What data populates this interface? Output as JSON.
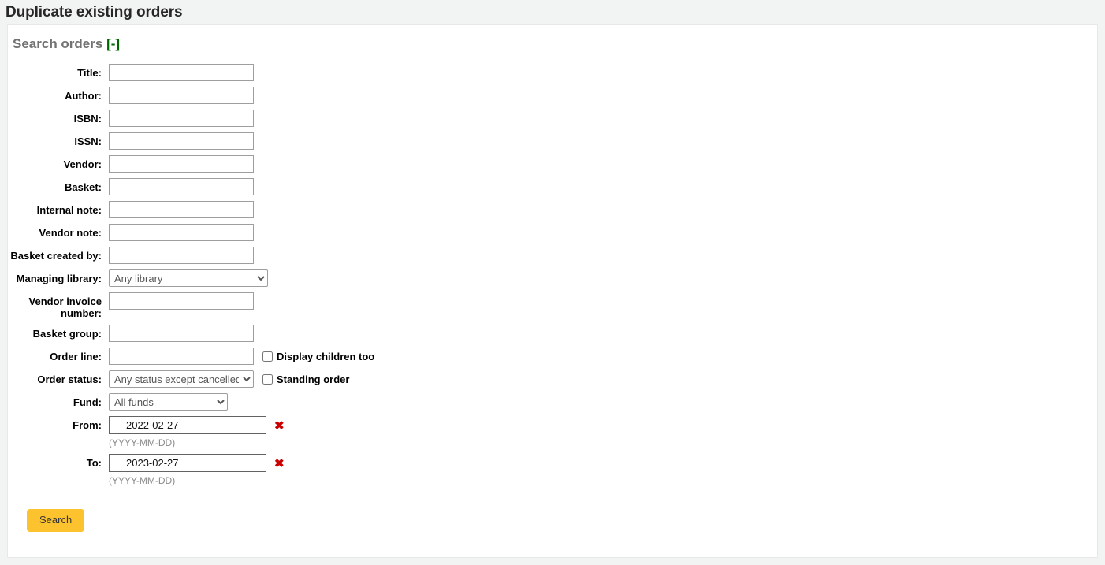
{
  "page": {
    "title": "Duplicate existing orders"
  },
  "panel": {
    "legend": "Search orders",
    "toggle": "[-]",
    "toggle_color": "#006600"
  },
  "form": {
    "fields": [
      {
        "label": "Title:",
        "name": "title",
        "type": "text",
        "value": "",
        "placeholder": ""
      },
      {
        "label": "Author:",
        "name": "author",
        "type": "text",
        "value": "",
        "placeholder": ""
      },
      {
        "label": "ISBN:",
        "name": "isbn",
        "type": "text",
        "value": "",
        "placeholder": ""
      },
      {
        "label": "ISSN:",
        "name": "issn",
        "type": "text",
        "value": "",
        "placeholder": ""
      },
      {
        "label": "Vendor:",
        "name": "vendor",
        "type": "text",
        "value": "",
        "placeholder": ""
      },
      {
        "label": "Basket:",
        "name": "basket",
        "type": "text",
        "value": "",
        "placeholder": ""
      },
      {
        "label": "Internal note:",
        "name": "internal-note",
        "type": "text",
        "value": "",
        "placeholder": ""
      },
      {
        "label": "Vendor note:",
        "name": "vendor-note",
        "type": "text",
        "value": "",
        "placeholder": ""
      },
      {
        "label": "Basket created by:",
        "name": "basket-created-by",
        "type": "text",
        "value": "",
        "placeholder": ""
      },
      {
        "label": "Managing library:",
        "name": "managing-library",
        "type": "select",
        "value": "Any library"
      },
      {
        "label": "Vendor invoice number:",
        "name": "vendor-invoice-number",
        "type": "text",
        "value": "",
        "placeholder": ""
      },
      {
        "label": "Basket group:",
        "name": "basket-group",
        "type": "text",
        "value": "",
        "placeholder": ""
      },
      {
        "label": "Order line:",
        "name": "order-line",
        "type": "text",
        "value": "",
        "placeholder": ""
      },
      {
        "label": "Order status:",
        "name": "order-status",
        "type": "select",
        "value": "Any status except cancelled"
      },
      {
        "label": "Fund:",
        "name": "fund",
        "type": "select",
        "value": "All funds"
      },
      {
        "label": "From:",
        "name": "date-from",
        "type": "date",
        "value": "2022-02-27"
      },
      {
        "label": "To:",
        "name": "date-to",
        "type": "date",
        "value": "2023-02-27"
      }
    ],
    "labels": {
      "title": "Title:",
      "author": "Author:",
      "isbn": "ISBN:",
      "issn": "ISSN:",
      "vendor": "Vendor:",
      "basket": "Basket:",
      "internal_note": "Internal note:",
      "vendor_note": "Vendor note:",
      "basket_created_by": "Basket created by:",
      "managing_library": "Managing library:",
      "vendor_invoice_number": "Vendor invoice number:",
      "basket_group": "Basket group:",
      "order_line": "Order line:",
      "order_status": "Order status:",
      "fund": "Fund:",
      "from": "From:",
      "to": "To:"
    },
    "selects": {
      "managing_library": {
        "selected": "Any library",
        "options": [
          "Any library"
        ]
      },
      "order_status": {
        "selected": "Any status except cancelled",
        "options": [
          "Any status except cancelled"
        ]
      },
      "fund": {
        "selected": "All funds",
        "options": [
          "All funds"
        ]
      }
    },
    "checkboxes": {
      "display_children": {
        "label": "Display children too",
        "checked": false
      },
      "standing_order": {
        "label": "Standing order",
        "checked": false
      }
    },
    "dates": {
      "from": {
        "value": "2022-02-27",
        "hint": "(YYYY-MM-DD)",
        "clear_icon": "✖"
      },
      "to": {
        "value": "2023-02-27",
        "hint": "(YYYY-MM-DD)",
        "clear_icon": "✖"
      }
    },
    "submit": {
      "label": "Search",
      "color": "#fcc32e"
    }
  }
}
